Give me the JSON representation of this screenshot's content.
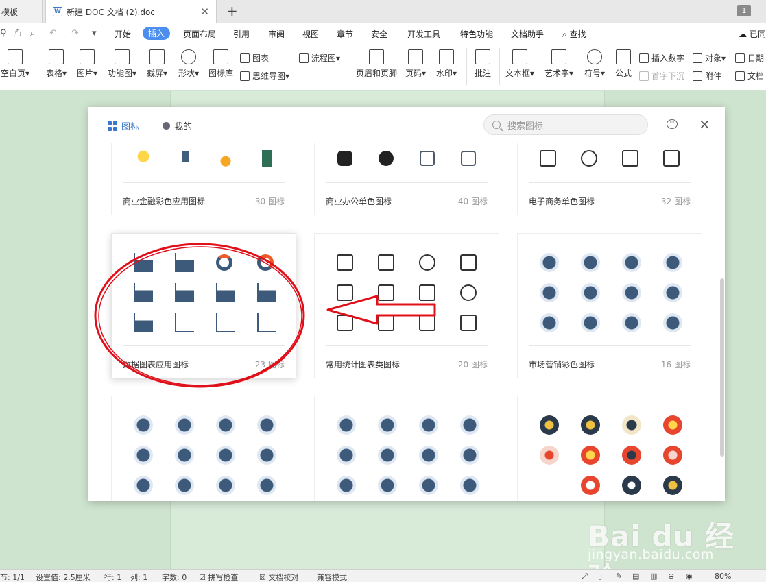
{
  "tabs": {
    "templates": "模板",
    "doc": "新建 DOC 文档 (2).doc",
    "page_count": "1"
  },
  "menu": {
    "items": [
      "开始",
      "插入",
      "页面布局",
      "引用",
      "审阅",
      "视图",
      "章节",
      "安全",
      "开发工具",
      "特色功能",
      "文档助手"
    ],
    "active": "插入",
    "search": "查找",
    "right": "已同"
  },
  "ribbon": {
    "blank_page": "空白页",
    "table": "表格",
    "picture": "图片",
    "function_chart": "功能图",
    "screenshot": "截屏",
    "shape": "形状",
    "icon_lib": "图标库",
    "chart": "图表",
    "mindmap": "思维导图",
    "flowchart": "流程图",
    "header_footer": "页眉和页脚",
    "page_num": "页码",
    "watermark": "水印",
    "comment": "批注",
    "textbox": "文本框",
    "wordart": "艺术字",
    "symbol": "符号",
    "formula": "公式",
    "insert_number": "插入数字",
    "object": "对象",
    "date": "日期",
    "dropcap": "首字下沉",
    "attachment": "附件",
    "docpart": "文档"
  },
  "dialog": {
    "tab_icons": "图标",
    "tab_mine": "我的",
    "search_placeholder": "搜索图标",
    "close": "×",
    "cards": [
      {
        "name": "商业金融彩色应用图标",
        "count": "30 图标"
      },
      {
        "name": "商业办公单色图标",
        "count": "40 图标"
      },
      {
        "name": "电子商务单色图标",
        "count": "32 图标"
      },
      {
        "name": "数据图表应用图标",
        "count": "23 图标"
      },
      {
        "name": "常用统计图表类图标",
        "count": "20 图标"
      },
      {
        "name": "市场营销彩色图标",
        "count": "16 图标"
      }
    ]
  },
  "status": {
    "section": "节: 1/1",
    "setting": "设置值: 2.5厘米",
    "row": "行: 1",
    "col": "列: 1",
    "words": "字数: 0",
    "spell": "拼写检查",
    "proof": "文档校对",
    "compat": "兼容模式",
    "zoom": "80%"
  },
  "watermark": {
    "main": "Bai du 经验",
    "sub": "jingyan.baidu.com"
  },
  "colors": {
    "accent": "#4b8ef0",
    "page_bg": "#cfe4cf",
    "annotation": "#e0101a"
  }
}
